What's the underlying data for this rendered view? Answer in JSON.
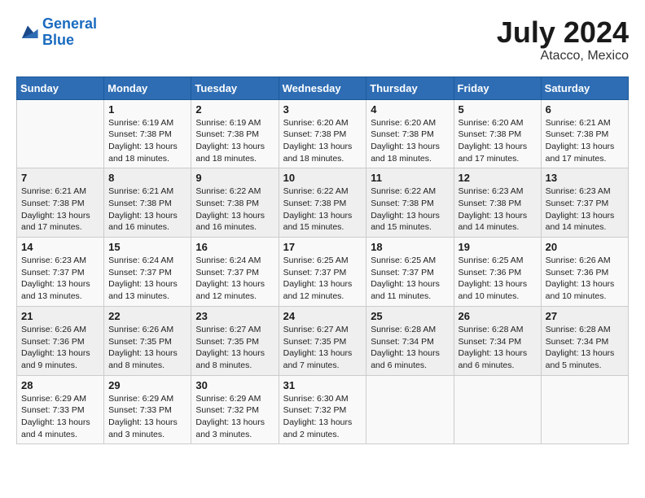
{
  "header": {
    "logo_line1": "General",
    "logo_line2": "Blue",
    "title": "July 2024",
    "subtitle": "Atacco, Mexico"
  },
  "calendar": {
    "days_of_week": [
      "Sunday",
      "Monday",
      "Tuesday",
      "Wednesday",
      "Thursday",
      "Friday",
      "Saturday"
    ],
    "weeks": [
      [
        {
          "day": "",
          "info": ""
        },
        {
          "day": "1",
          "info": "Sunrise: 6:19 AM\nSunset: 7:38 PM\nDaylight: 13 hours\nand 18 minutes."
        },
        {
          "day": "2",
          "info": "Sunrise: 6:19 AM\nSunset: 7:38 PM\nDaylight: 13 hours\nand 18 minutes."
        },
        {
          "day": "3",
          "info": "Sunrise: 6:20 AM\nSunset: 7:38 PM\nDaylight: 13 hours\nand 18 minutes."
        },
        {
          "day": "4",
          "info": "Sunrise: 6:20 AM\nSunset: 7:38 PM\nDaylight: 13 hours\nand 18 minutes."
        },
        {
          "day": "5",
          "info": "Sunrise: 6:20 AM\nSunset: 7:38 PM\nDaylight: 13 hours\nand 17 minutes."
        },
        {
          "day": "6",
          "info": "Sunrise: 6:21 AM\nSunset: 7:38 PM\nDaylight: 13 hours\nand 17 minutes."
        }
      ],
      [
        {
          "day": "7",
          "info": "Sunrise: 6:21 AM\nSunset: 7:38 PM\nDaylight: 13 hours\nand 17 minutes."
        },
        {
          "day": "8",
          "info": "Sunrise: 6:21 AM\nSunset: 7:38 PM\nDaylight: 13 hours\nand 16 minutes."
        },
        {
          "day": "9",
          "info": "Sunrise: 6:22 AM\nSunset: 7:38 PM\nDaylight: 13 hours\nand 16 minutes."
        },
        {
          "day": "10",
          "info": "Sunrise: 6:22 AM\nSunset: 7:38 PM\nDaylight: 13 hours\nand 15 minutes."
        },
        {
          "day": "11",
          "info": "Sunrise: 6:22 AM\nSunset: 7:38 PM\nDaylight: 13 hours\nand 15 minutes."
        },
        {
          "day": "12",
          "info": "Sunrise: 6:23 AM\nSunset: 7:38 PM\nDaylight: 13 hours\nand 14 minutes."
        },
        {
          "day": "13",
          "info": "Sunrise: 6:23 AM\nSunset: 7:37 PM\nDaylight: 13 hours\nand 14 minutes."
        }
      ],
      [
        {
          "day": "14",
          "info": "Sunrise: 6:23 AM\nSunset: 7:37 PM\nDaylight: 13 hours\nand 13 minutes."
        },
        {
          "day": "15",
          "info": "Sunrise: 6:24 AM\nSunset: 7:37 PM\nDaylight: 13 hours\nand 13 minutes."
        },
        {
          "day": "16",
          "info": "Sunrise: 6:24 AM\nSunset: 7:37 PM\nDaylight: 13 hours\nand 12 minutes."
        },
        {
          "day": "17",
          "info": "Sunrise: 6:25 AM\nSunset: 7:37 PM\nDaylight: 13 hours\nand 12 minutes."
        },
        {
          "day": "18",
          "info": "Sunrise: 6:25 AM\nSunset: 7:37 PM\nDaylight: 13 hours\nand 11 minutes."
        },
        {
          "day": "19",
          "info": "Sunrise: 6:25 AM\nSunset: 7:36 PM\nDaylight: 13 hours\nand 10 minutes."
        },
        {
          "day": "20",
          "info": "Sunrise: 6:26 AM\nSunset: 7:36 PM\nDaylight: 13 hours\nand 10 minutes."
        }
      ],
      [
        {
          "day": "21",
          "info": "Sunrise: 6:26 AM\nSunset: 7:36 PM\nDaylight: 13 hours\nand 9 minutes."
        },
        {
          "day": "22",
          "info": "Sunrise: 6:26 AM\nSunset: 7:35 PM\nDaylight: 13 hours\nand 8 minutes."
        },
        {
          "day": "23",
          "info": "Sunrise: 6:27 AM\nSunset: 7:35 PM\nDaylight: 13 hours\nand 8 minutes."
        },
        {
          "day": "24",
          "info": "Sunrise: 6:27 AM\nSunset: 7:35 PM\nDaylight: 13 hours\nand 7 minutes."
        },
        {
          "day": "25",
          "info": "Sunrise: 6:28 AM\nSunset: 7:34 PM\nDaylight: 13 hours\nand 6 minutes."
        },
        {
          "day": "26",
          "info": "Sunrise: 6:28 AM\nSunset: 7:34 PM\nDaylight: 13 hours\nand 6 minutes."
        },
        {
          "day": "27",
          "info": "Sunrise: 6:28 AM\nSunset: 7:34 PM\nDaylight: 13 hours\nand 5 minutes."
        }
      ],
      [
        {
          "day": "28",
          "info": "Sunrise: 6:29 AM\nSunset: 7:33 PM\nDaylight: 13 hours\nand 4 minutes."
        },
        {
          "day": "29",
          "info": "Sunrise: 6:29 AM\nSunset: 7:33 PM\nDaylight: 13 hours\nand 3 minutes."
        },
        {
          "day": "30",
          "info": "Sunrise: 6:29 AM\nSunset: 7:32 PM\nDaylight: 13 hours\nand 3 minutes."
        },
        {
          "day": "31",
          "info": "Sunrise: 6:30 AM\nSunset: 7:32 PM\nDaylight: 13 hours\nand 2 minutes."
        },
        {
          "day": "",
          "info": ""
        },
        {
          "day": "",
          "info": ""
        },
        {
          "day": "",
          "info": ""
        }
      ]
    ]
  }
}
